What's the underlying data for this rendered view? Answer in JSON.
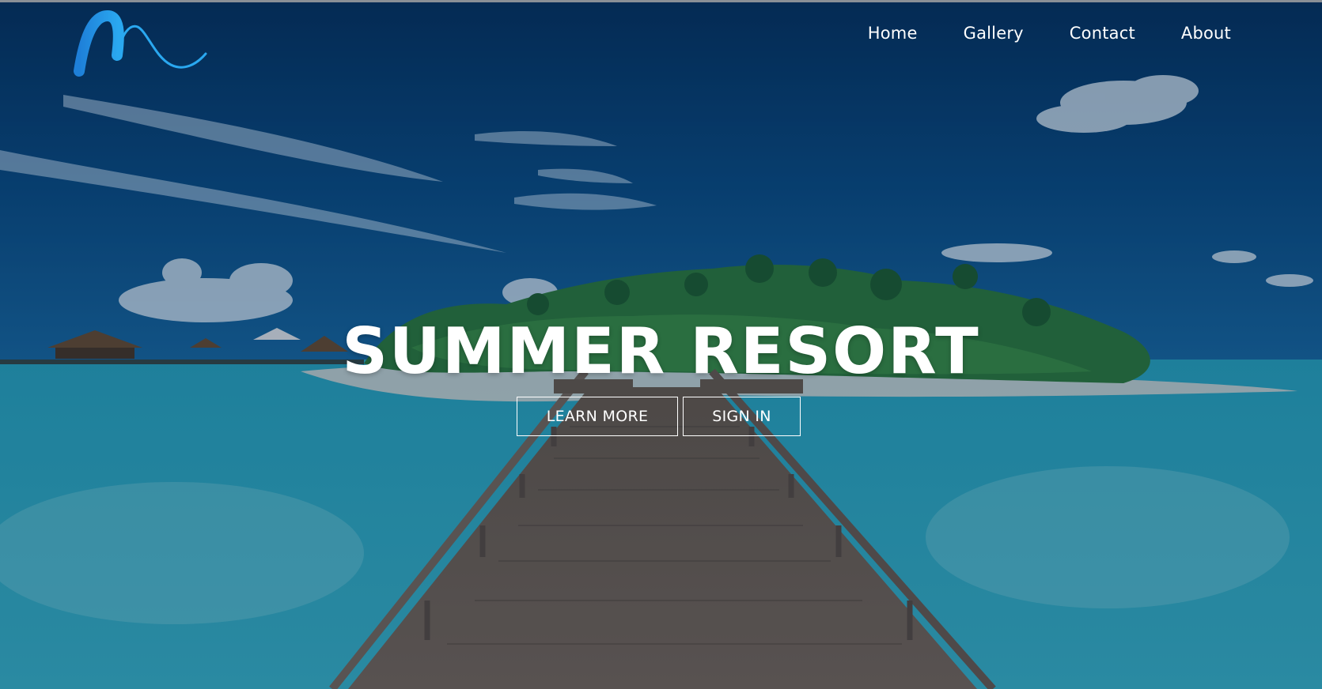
{
  "nav": {
    "items": [
      {
        "label": "Home"
      },
      {
        "label": "Gallery"
      },
      {
        "label": "Contact"
      },
      {
        "label": "About"
      }
    ]
  },
  "hero": {
    "title": "SUMMER RESORT",
    "learn_more_label": "LEARN MORE",
    "sign_in_label": "SIGN IN"
  },
  "colors": {
    "sky": "#0a3a6b",
    "sea": "#2a9bb0",
    "logo_blue": "#1e88e5",
    "text": "#ffffff"
  },
  "icons": {
    "logo": "wave-m-logo"
  }
}
